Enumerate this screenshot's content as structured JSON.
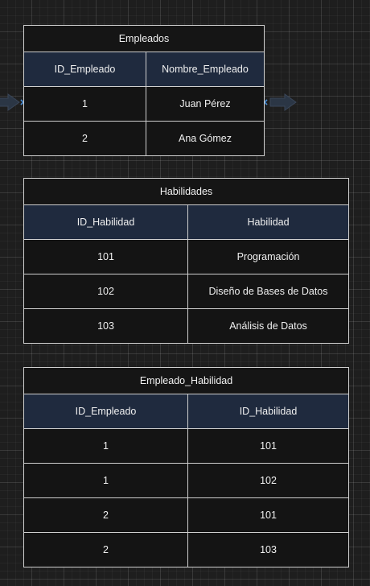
{
  "tables": [
    {
      "title": "Empleados",
      "columns": [
        "ID_Empleado",
        "Nombre_Empleado"
      ],
      "rows": [
        [
          "1",
          "Juan Pérez"
        ],
        [
          "2",
          "Ana Gómez"
        ]
      ]
    },
    {
      "title": "Habilidades",
      "columns": [
        "ID_Habilidad",
        "Habilidad"
      ],
      "rows": [
        [
          "101",
          "Programación"
        ],
        [
          "102",
          "Diseño de Bases de Datos"
        ],
        [
          "103",
          "Análisis de Datos"
        ]
      ]
    },
    {
      "title": "Empleado_Habilidad",
      "columns": [
        "ID_Empleado",
        "ID_Habilidad"
      ],
      "rows": [
        [
          "1",
          "101"
        ],
        [
          "1",
          "102"
        ],
        [
          "2",
          "101"
        ],
        [
          "2",
          "103"
        ]
      ]
    }
  ],
  "colors": {
    "header_fill": "#1f2a3e",
    "border": "#cfcfcf",
    "connector_arrow": "#2b3645",
    "connector_point": "#4a90d9"
  }
}
